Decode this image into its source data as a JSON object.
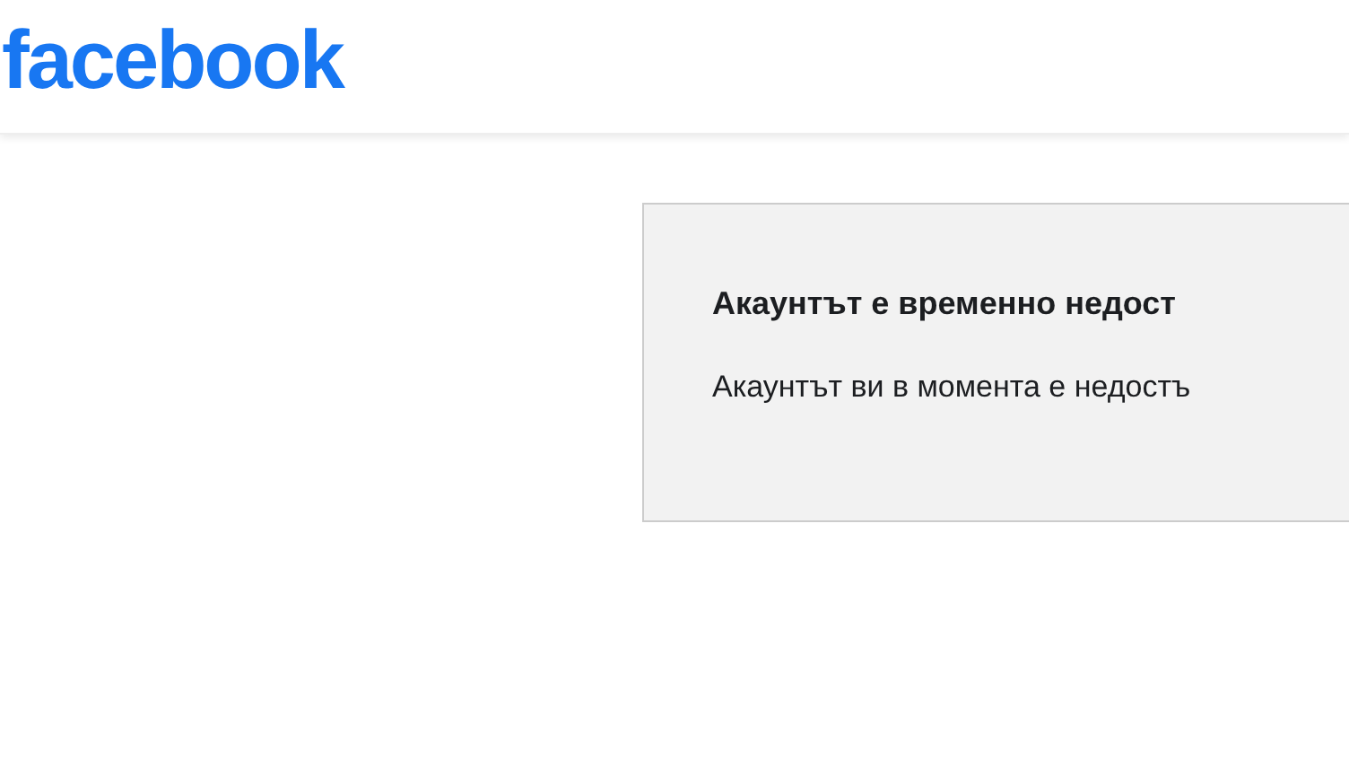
{
  "header": {
    "logo": "facebook"
  },
  "notice": {
    "title": "Акаунтът е временно недост",
    "message": "Акаунтът ви в момента е недостъ"
  }
}
